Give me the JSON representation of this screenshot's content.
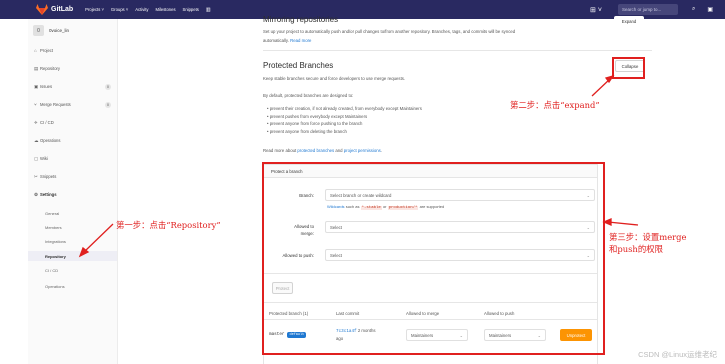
{
  "topbar": {
    "logo_text": "GitLab",
    "nav": [
      "Projects ˅",
      "Groups ˅",
      "Activity",
      "Milestones",
      "Snippets"
    ],
    "nav_icon": "chart-icon",
    "plus": "⊞ ˅",
    "search_placeholder": "Search or jump to...",
    "icons": [
      "search-icon",
      "todo-icon",
      "user-icon"
    ]
  },
  "sidebar": {
    "avatar_letter": "0",
    "project_name": "0voice_lin",
    "items": [
      {
        "icon": "⌂",
        "label": "Project"
      },
      {
        "icon": "▤",
        "label": "Repository"
      },
      {
        "icon": "▣",
        "label": "Issues",
        "count": "0"
      },
      {
        "icon": "⑂",
        "label": "Merge Requests",
        "count": "0"
      },
      {
        "icon": "✈",
        "label": "CI / CD"
      },
      {
        "icon": "☁",
        "label": "Operations"
      },
      {
        "icon": "▢",
        "label": "Wiki"
      },
      {
        "icon": "✂",
        "label": "Snippets"
      },
      {
        "icon": "⚙",
        "label": "Settings"
      }
    ],
    "sub_items": [
      "General",
      "Members",
      "Integrations",
      "Repository",
      "CI / CD",
      "Operations"
    ]
  },
  "mirroring": {
    "title": "Mirroring repositories",
    "desc": "Set up your project to automatically push and/or pull changes to/from another repository. Branches, tags, and commits will be synced",
    "desc2": "automatically.",
    "read_more": "Read more",
    "expand_label": "Expand"
  },
  "protected": {
    "title": "Protected Branches",
    "desc": "Keep stable branches secure and force developers to use merge requests.",
    "collapse_label": "Collapse",
    "intro": "By default, protected branches are designed to:",
    "bullets": [
      "prevent their creation, if not already created, from everybody except Maintainers",
      "prevent pushes from everybody except Maintainers",
      "prevent anyone from force pushing to the branch",
      "prevent anyone from deleting the branch"
    ],
    "read_more_pre": "Read more about",
    "read_more_link1": "protected branches",
    "read_more_and": "and",
    "read_more_link2": "project permissions",
    "read_more_end": "."
  },
  "form": {
    "header": "Protect a branch",
    "branch_label": "Branch:",
    "branch_placeholder": "Select branch or create wildcard",
    "wildcards_link": "Wildcards",
    "wildcards_such": "such as",
    "code1": "*-stable",
    "wildcards_or": "or",
    "code2": "production/*",
    "wildcards_end": "are supported",
    "merge_label_1": "Allowed to",
    "merge_label_2": "merge:",
    "merge_value": "Select",
    "push_label": "Allowed to push:",
    "push_value": "Select",
    "protect_label": "Protect"
  },
  "table": {
    "headers": [
      "Protected branch (1)",
      "Last commit",
      "Allowed to merge",
      "Allowed to push"
    ],
    "row": {
      "branch": "master",
      "badge": "default",
      "commit": "7c3c1a4f",
      "commit_age": "2 months",
      "commit_age2": "ago",
      "merge": "Maintainers",
      "push": "Maintainers",
      "unprotect": "Unprotect"
    }
  },
  "annotations": {
    "step1": "第一步：点击“Repository”",
    "step2": "第二步：点击“expand”",
    "step3_line1": "第三步：设置merge",
    "step3_line2": "和push的权限"
  },
  "colors": {
    "topbar": "#292961",
    "accent": "#1f78d1",
    "annotation": "#e0201f",
    "unprotect": "#fc9403"
  },
  "watermark": "CSDN @Linux运维老纪"
}
